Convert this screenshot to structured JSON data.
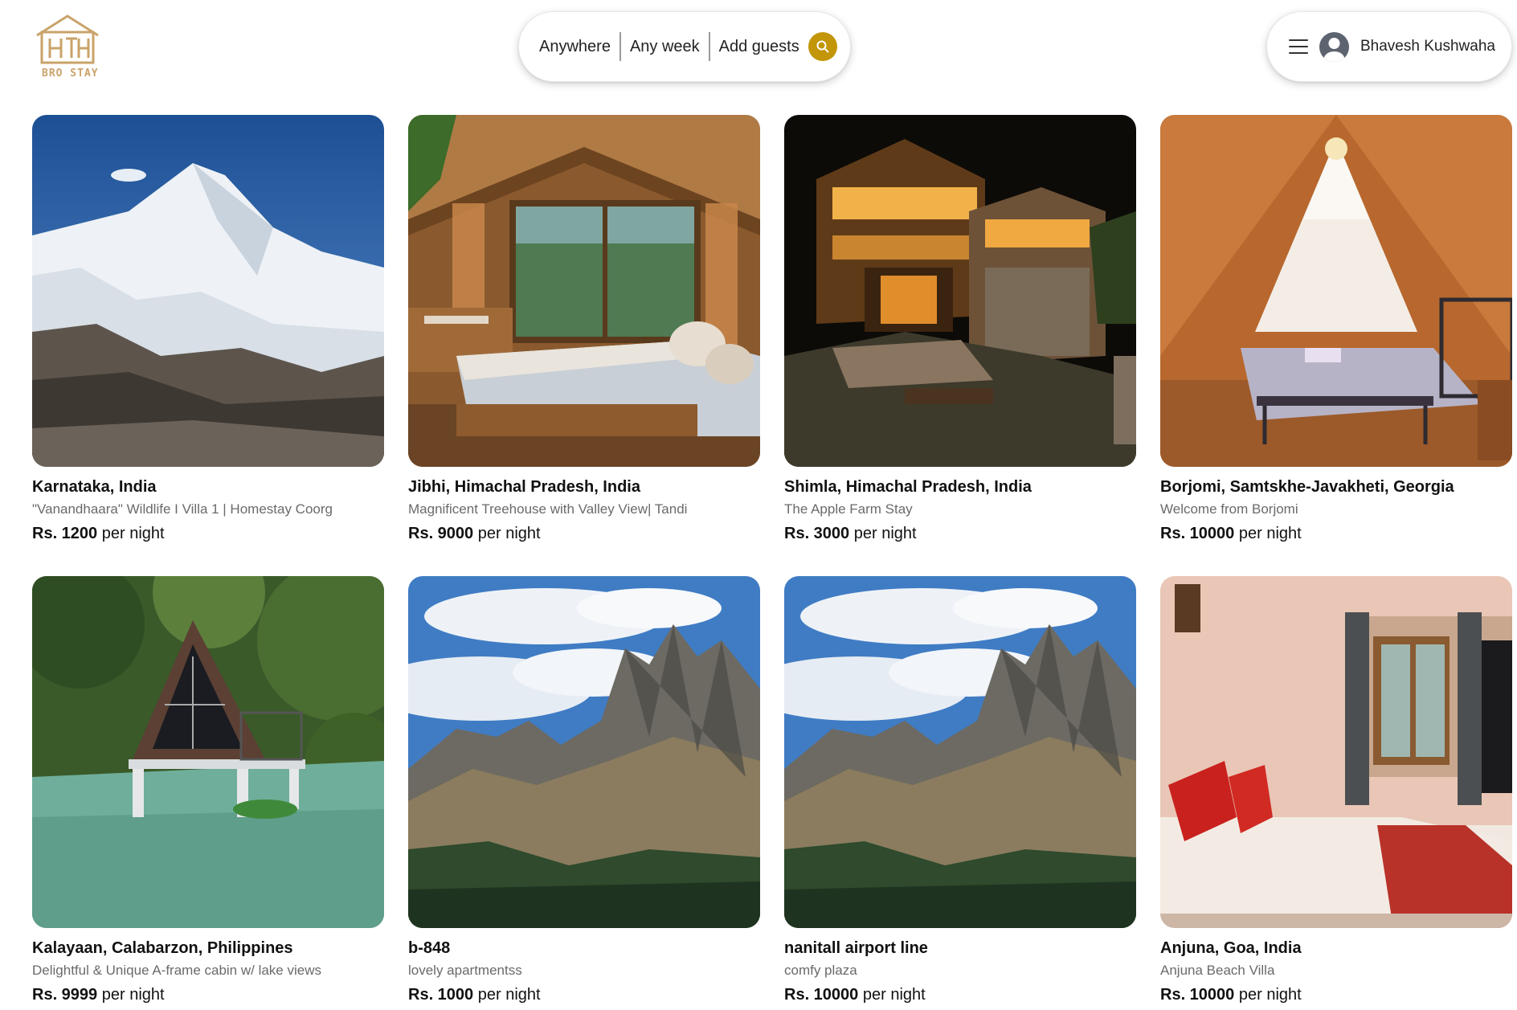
{
  "brand": {
    "name": "BRO STAY",
    "accent": "#c29608"
  },
  "search": {
    "anywhere": "Anywhere",
    "any_week": "Any week",
    "add_guests": "Add guests",
    "button_icon": "search-icon"
  },
  "user": {
    "name": "Bhavesh Kushwaha",
    "menu_icon": "menu-icon",
    "avatar_icon": "user-avatar-icon"
  },
  "listings": [
    {
      "location": "Karnataka, India",
      "title": "\"Vanandhaara\" Wildlife I Villa 1 | Homestay Coorg",
      "price": "Rs. 1200",
      "unit": "per night",
      "image": "snowy-mountain"
    },
    {
      "location": "Jibhi, Himachal Pradesh, India",
      "title": "Magnificent Treehouse with Valley View| Tandi",
      "price": "Rs. 9000",
      "unit": "per night",
      "image": "wooden-bedroom"
    },
    {
      "location": "Shimla, Himachal Pradesh, India",
      "title": "The Apple Farm Stay",
      "price": "Rs. 3000",
      "unit": "per night",
      "image": "lit-house-night"
    },
    {
      "location": "Borjomi, Samtskhe-Javakheti, Georgia",
      "title": "Welcome from Borjomi",
      "price": "Rs. 10000",
      "unit": "per night",
      "image": "attic-bedroom"
    },
    {
      "location": "Kalayaan, Calabarzon, Philippines",
      "title": "Delightful & Unique A-frame cabin w/ lake views",
      "price": "Rs. 9999",
      "unit": "per night",
      "image": "a-frame-lake"
    },
    {
      "location": "b-848",
      "title": "lovely apartmentss",
      "price": "Rs. 1000",
      "unit": "per night",
      "image": "rocky-peaks"
    },
    {
      "location": "nanitall airport line",
      "title": "comfy plaza",
      "price": "Rs. 10000",
      "unit": "per night",
      "image": "rocky-peaks"
    },
    {
      "location": "Anjuna, Goa, India",
      "title": "Anjuna Beach Villa",
      "price": "Rs. 10000",
      "unit": "per night",
      "image": "villa-bedroom"
    }
  ]
}
